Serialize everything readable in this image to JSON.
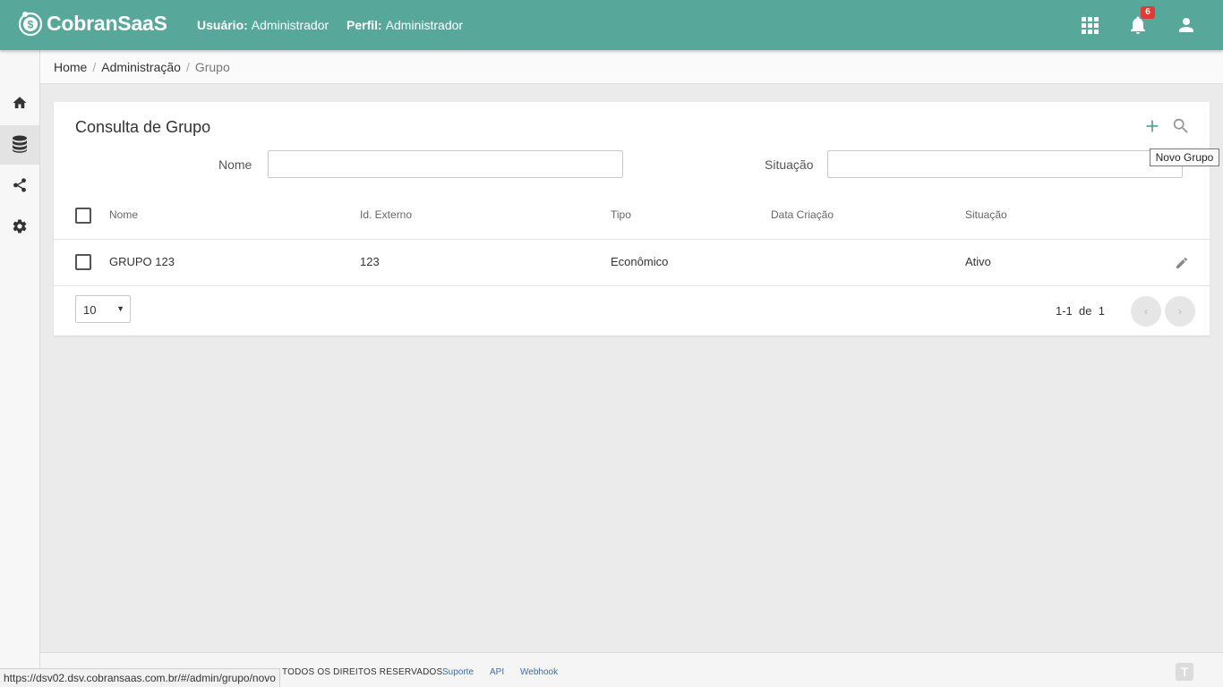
{
  "header": {
    "app_name": "CobranSaaS",
    "user_label": "Usuário:",
    "user_value": "Administrador",
    "profile_label": "Perfil:",
    "profile_value": "Administrador",
    "notification_count": "6",
    "bg_color": "#57a89a"
  },
  "sidebar": {
    "items": [
      {
        "icon": "home-icon"
      },
      {
        "icon": "database-icon"
      },
      {
        "icon": "share-icon"
      },
      {
        "icon": "gear-icon"
      }
    ]
  },
  "breadcrumb": {
    "items": [
      "Home",
      "Administração",
      "Grupo"
    ],
    "separator": "/"
  },
  "card": {
    "title": "Consulta de Grupo",
    "tooltip": "Novo Grupo",
    "filters": {
      "nome_label": "Nome",
      "nome_value": "",
      "situacao_label": "Situação",
      "situacao_value": ""
    },
    "table": {
      "columns": [
        "Nome",
        "Id. Externo",
        "Tipo",
        "Data Criação",
        "Situação"
      ],
      "rows": [
        {
          "nome": "GRUPO 123",
          "id_externo": "123",
          "tipo": "Econômico",
          "data_criacao": "",
          "situacao": "Ativo"
        }
      ]
    },
    "pagination": {
      "page_size": "10",
      "range": "1-1",
      "of_label": "de",
      "total": "1",
      "prev": "‹",
      "next": "›"
    }
  },
  "footer": {
    "rights": "TODOS OS DIREITOS RESERVADOS.",
    "links": [
      "Suporte",
      "API",
      "Webhook"
    ],
    "logo": "T"
  },
  "status_url": "https://dsv02.dsv.cobransaas.com.br/#/admin/grupo/novo"
}
